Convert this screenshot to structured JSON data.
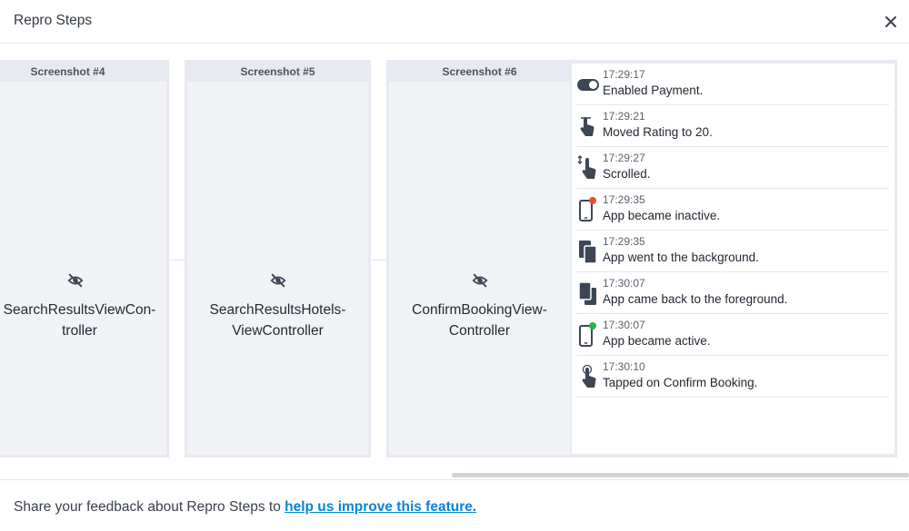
{
  "header": {
    "title": "Repro Steps"
  },
  "screenshots": [
    {
      "label": "Screenshot #4",
      "name_line1": "SearchResultsViewCon-",
      "name_line2": "troller"
    },
    {
      "label": "Screenshot #5",
      "name_line1": "SearchResultsHotels-",
      "name_line2": "ViewController"
    },
    {
      "label": "Screenshot #6",
      "name_line1": "ConfirmBookingView-",
      "name_line2": "Controller"
    }
  ],
  "log": [
    {
      "icon": "toggle-icon",
      "time": "17:29:17",
      "text": "Enabled Payment."
    },
    {
      "icon": "slider-gesture-icon",
      "time": "17:29:21",
      "text": "Moved Rating to 20."
    },
    {
      "icon": "scroll-gesture-icon",
      "time": "17:29:27",
      "text": "Scrolled."
    },
    {
      "icon": "phone-inactive-icon",
      "time": "17:29:35",
      "text": "App became inactive."
    },
    {
      "icon": "app-background-icon",
      "time": "17:29:35",
      "text": "App went to the background."
    },
    {
      "icon": "app-foreground-icon",
      "time": "17:30:07",
      "text": "App came back to the foreground."
    },
    {
      "icon": "phone-active-icon",
      "time": "17:30:07",
      "text": "App became active."
    },
    {
      "icon": "tap-gesture-icon",
      "time": "17:30:10",
      "text": "Tapped on Confirm Booking."
    }
  ],
  "footer": {
    "prefix": "Share your feedback about Repro Steps to ",
    "link": "help us improve this feature."
  },
  "colors": {
    "link": "#0a84d6",
    "inactive_dot": "#e8502f",
    "active_dot": "#2bb14a",
    "icon": "#3d4654"
  }
}
